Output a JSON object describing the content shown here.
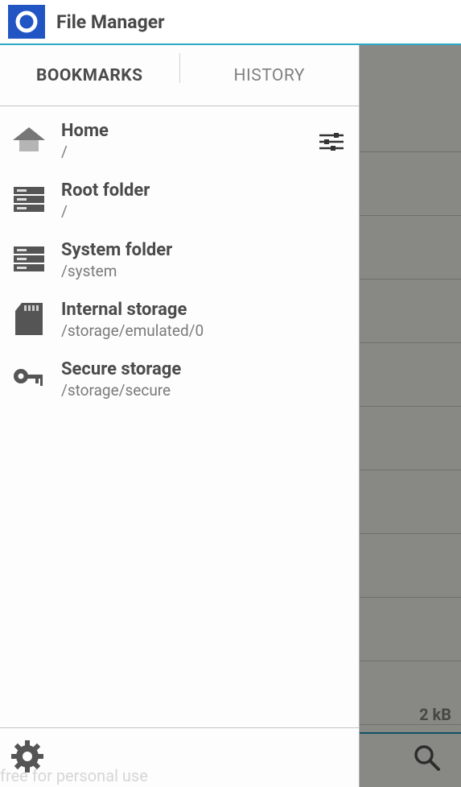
{
  "header": {
    "title": "File Manager"
  },
  "tabs": {
    "bookmarks": "BOOKMARKS",
    "history": "HISTORY"
  },
  "bookmarks": [
    {
      "icon": "home",
      "title": "Home",
      "path": "/"
    },
    {
      "icon": "drive",
      "title": "Root folder",
      "path": "/"
    },
    {
      "icon": "drive",
      "title": "System folder",
      "path": "/system"
    },
    {
      "icon": "sd",
      "title": "Internal storage",
      "path": "/storage/emulated/0"
    },
    {
      "icon": "key",
      "title": "Secure storage",
      "path": "/storage/secure"
    }
  ],
  "background": {
    "size_label": "2 kB"
  },
  "watermark": "free for personal use"
}
